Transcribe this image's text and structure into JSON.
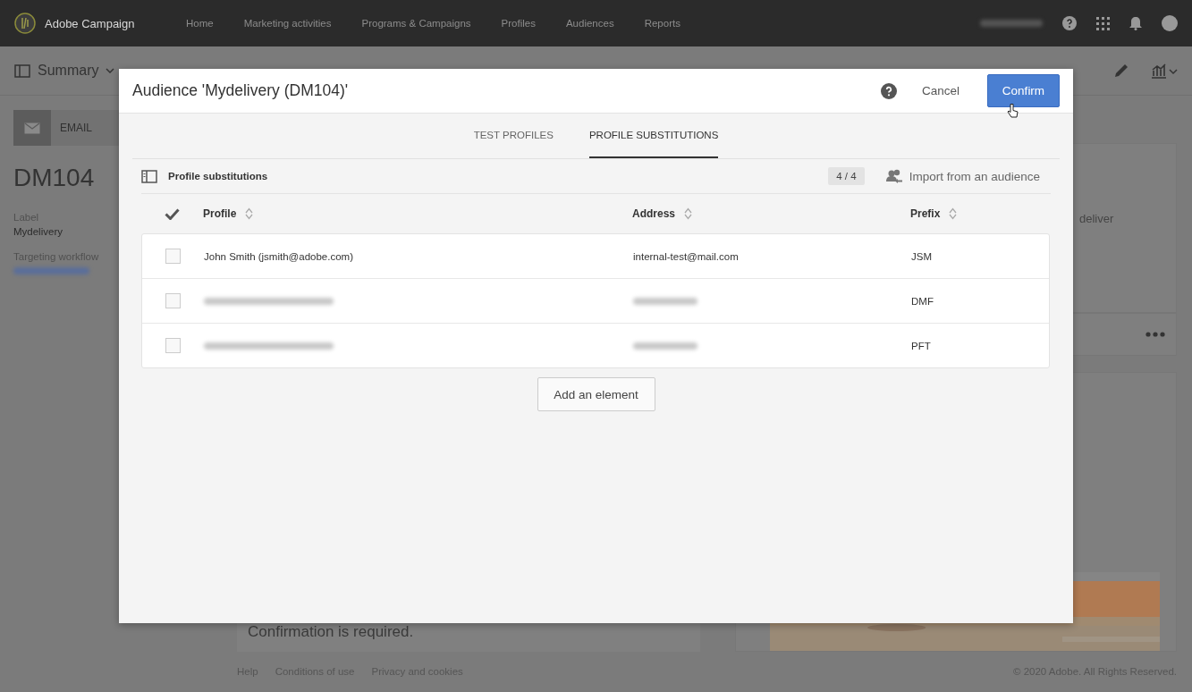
{
  "app": {
    "name": "Adobe Campaign",
    "nav": [
      "Home",
      "Marketing activities",
      "Programs & Campaigns",
      "Profiles",
      "Audiences",
      "Reports"
    ],
    "user": {
      "redacted": true
    }
  },
  "toolbar": {
    "view": "Summary"
  },
  "sidebar": {
    "channel": "EMAIL",
    "code": "DM104",
    "fields": [
      {
        "label": "Label",
        "value": "Mydelivery",
        "redacted": false
      },
      {
        "label": "Targeting workflow",
        "redacted": true
      }
    ]
  },
  "cards": {
    "delivery_label": "deliver",
    "warning": "Confirmation is required."
  },
  "footer": {
    "links": [
      "Help",
      "Conditions of use",
      "Privacy and cookies"
    ],
    "copyright": "© 2020 Adobe. All Rights Reserved."
  },
  "dialog": {
    "title": "Audience 'Mydelivery (DM104)'",
    "cancel": "Cancel",
    "confirm": "Confirm",
    "tabs": [
      {
        "label": "TEST PROFILES",
        "selected": false
      },
      {
        "label": "PROFILE SUBSTITUTIONS",
        "selected": true
      }
    ],
    "section": {
      "title": "Profile substitutions",
      "count": "4 / 4",
      "import": "Import from an audience"
    },
    "table": {
      "columns": [
        "Profile",
        "Address",
        "Prefix"
      ],
      "rows": [
        {
          "checked": false,
          "redacted": false,
          "profile": "John Smith (jsmith@adobe.com)",
          "address": "internal-test@mail.com",
          "prefix": "JSM"
        },
        {
          "checked": false,
          "redacted": true,
          "prefix": "DMF"
        },
        {
          "checked": false,
          "redacted": true,
          "prefix": "PFT"
        }
      ]
    },
    "add_button": "Add an element"
  }
}
